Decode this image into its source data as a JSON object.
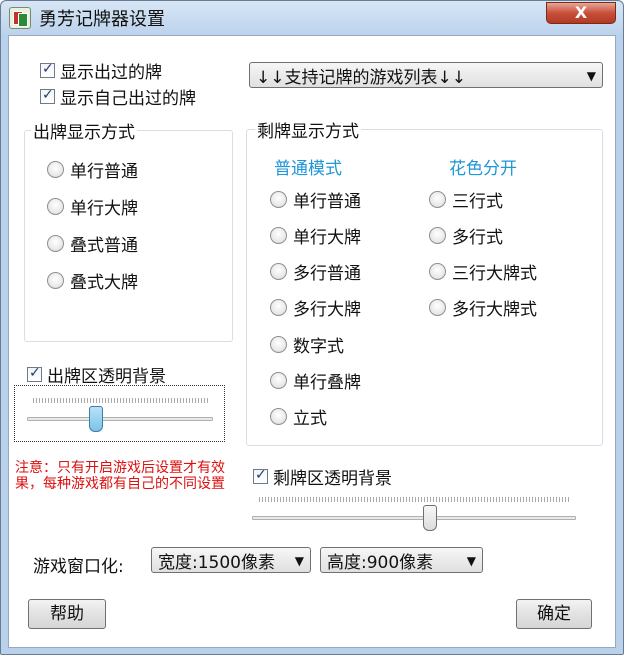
{
  "window": {
    "title": "勇芳记牌器设置",
    "close_label": "X"
  },
  "checkboxes": {
    "show_played": {
      "label": "显示出过的牌",
      "checked": true
    },
    "show_own_played": {
      "label": "显示自己出过的牌",
      "checked": true
    },
    "played_area_transparent": {
      "label": "出牌区透明背景",
      "checked": true
    },
    "remaining_area_transparent": {
      "label": "剩牌区透明背景",
      "checked": true
    }
  },
  "game_list_combo": {
    "value": "↓↓支持记牌的游戏列表↓↓"
  },
  "played_display": {
    "label": "出牌显示方式",
    "options": [
      "单行普通",
      "单行大牌",
      "叠式普通",
      "叠式大牌"
    ]
  },
  "remaining_display": {
    "label": "剩牌显示方式",
    "normal_mode_label": "普通模式",
    "suit_split_label": "花色分开",
    "normal_options": [
      "单行普通",
      "单行大牌",
      "多行普通",
      "多行大牌",
      "数字式",
      "单行叠牌",
      "立式"
    ],
    "suit_options": [
      "三行式",
      "多行式",
      "三行大牌式",
      "多行大牌式"
    ]
  },
  "note": "注意：只有开启游戏后设置才有效果，每种游戏都有自己的不同设置",
  "window_mode": {
    "label": "游戏窗口化:",
    "width_value": "宽度:1500像素",
    "height_value": "高度:900像素"
  },
  "sliders": {
    "played_opacity": 0.36,
    "remaining_opacity": 0.55
  },
  "buttons": {
    "help": "帮助",
    "ok": "确定"
  },
  "colors": {
    "accent_blue": "#1e96d7",
    "note_red": "#dd1111",
    "titlebar": "#bcd3ec"
  }
}
